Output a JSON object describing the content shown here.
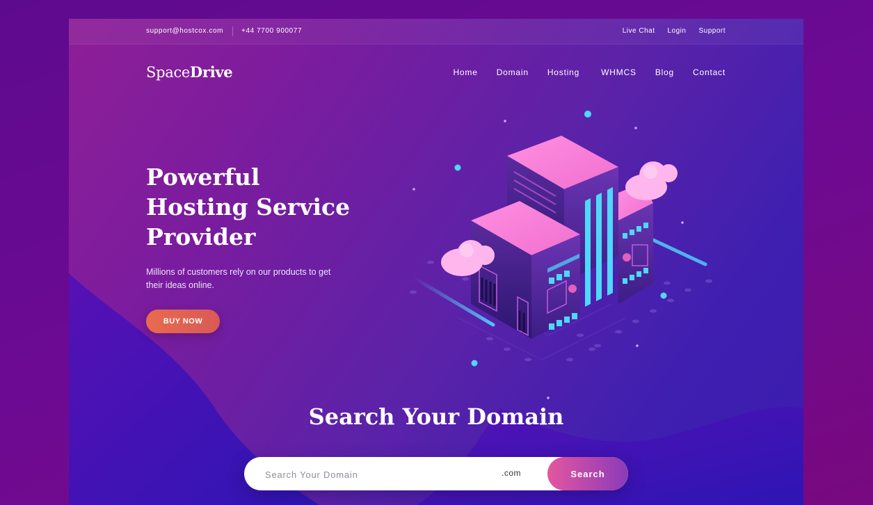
{
  "topbar": {
    "email": "support@hostcox.com",
    "phone": "+44 7700 900077",
    "links": [
      "Live Chat",
      "Login",
      "Support"
    ]
  },
  "brand": {
    "light": "Space",
    "bold": "Drive"
  },
  "nav": {
    "items": [
      "Home",
      "Domain",
      "Hosting",
      "WHMCS",
      "Blog",
      "Contact"
    ]
  },
  "hero": {
    "title_lines": [
      "Powerful",
      "Hosting Service",
      "Provider"
    ],
    "description": "Millions of customers rely on our products to get their ideas online.",
    "cta_label": "BUY NOW",
    "illustration_icon": "isometric-server-building-icon"
  },
  "domain_search": {
    "title": "Search Your Domain",
    "placeholder": "Search Your Domain",
    "tld": ".com",
    "button_label": "Search"
  },
  "colors": {
    "accent": "#e4569f",
    "cta": "#e0634f",
    "building_top": "#ff7fd8",
    "neon": "#4fd8ff"
  }
}
